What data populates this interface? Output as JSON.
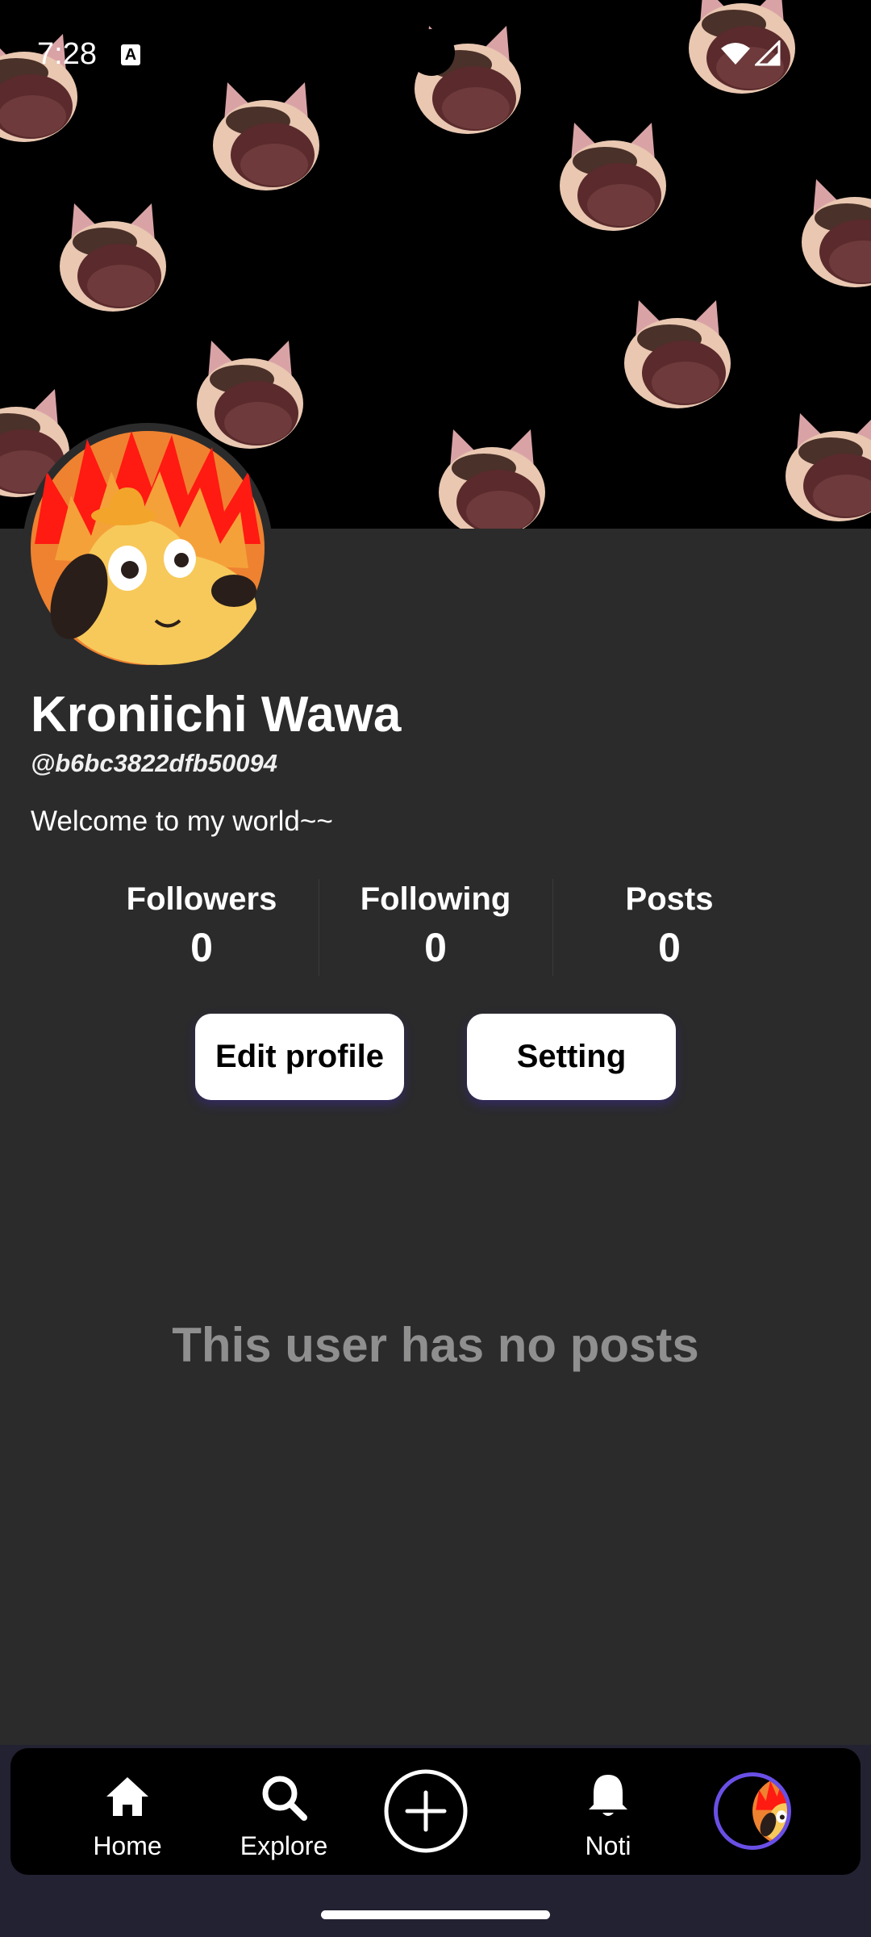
{
  "status_bar": {
    "time": "7:28",
    "keyboard_indicator": "A"
  },
  "profile": {
    "display_name": "Kroniichi Wawa",
    "username": "@b6bc3822dfb50094",
    "bio": "Welcome to my world~~"
  },
  "stats": [
    {
      "label": "Followers",
      "value": "0"
    },
    {
      "label": "Following",
      "value": "0"
    },
    {
      "label": "Posts",
      "value": "0"
    }
  ],
  "actions": {
    "edit_label": "Edit profile",
    "setting_label": "Setting"
  },
  "empty_message": "This user has no posts",
  "nav": {
    "home": "Home",
    "explore": "Explore",
    "noti": "Noti",
    "icons": [
      "home-icon",
      "search-icon",
      "add-circle-icon",
      "bell-icon",
      "profile-avatar"
    ]
  },
  "colors": {
    "background": "#2b2b2c",
    "banner": "#000000",
    "nav_bar": "#000000",
    "accent_ring": "#6a4fe6",
    "muted_text": "#8f8f8f"
  }
}
